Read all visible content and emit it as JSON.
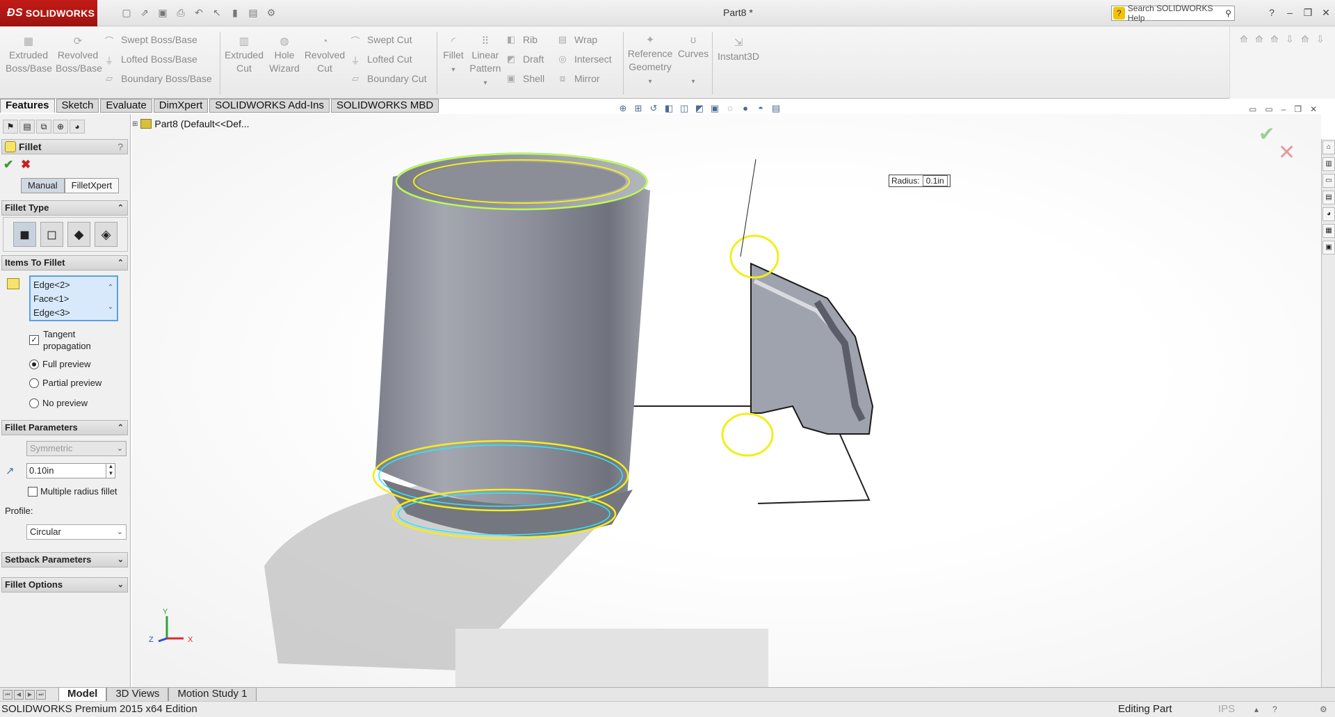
{
  "app": {
    "brand": "SOLIDWORKS",
    "document_title": "Part8 *"
  },
  "search": {
    "placeholder": "Search SOLIDWORKS Help"
  },
  "commands": {
    "extruded_boss": "Extruded Boss/Base",
    "revolved_boss": "Revolved Boss/Base",
    "swept_boss": "Swept Boss/Base",
    "lofted_boss": "Lofted Boss/Base",
    "boundary_boss": "Boundary Boss/Base",
    "extruded_cut": "Extruded Cut",
    "hole_wizard": "Hole Wizard",
    "revolved_cut": "Revolved Cut",
    "swept_cut": "Swept Cut",
    "lofted_cut": "Lofted Cut",
    "boundary_cut": "Boundary Cut",
    "fillet": "Fillet",
    "linear_pattern": "Linear Pattern",
    "rib": "Rib",
    "draft": "Draft",
    "shell": "Shell",
    "wrap": "Wrap",
    "intersect": "Intersect",
    "mirror": "Mirror",
    "reference_geometry": "Reference Geometry",
    "curves": "Curves",
    "instant3d": "Instant3D"
  },
  "tabs": [
    "Features",
    "Sketch",
    "Evaluate",
    "DimXpert",
    "SOLIDWORKS Add-Ins",
    "SOLIDWORKS MBD"
  ],
  "tree": {
    "root": "Part8  (Default<<Def..."
  },
  "property_manager": {
    "title": "Fillet",
    "help": "?",
    "mode_tabs": [
      "Manual",
      "FilletXpert"
    ],
    "fillet_type": {
      "header": "Fillet Type"
    },
    "items_to_fillet": {
      "header": "Items To Fillet",
      "items": [
        "Edge<2>",
        "Face<1>",
        "Edge<3>"
      ],
      "tangent_propagation": "Tangent propagation",
      "tangent_checked": true,
      "preview_options": [
        "Full preview",
        "Partial preview",
        "No preview"
      ],
      "preview_selected": "Full preview"
    },
    "fillet_parameters": {
      "header": "Fillet Parameters",
      "symmetric": "Symmetric",
      "radius": "0.10in",
      "multiple_radius": "Multiple radius fillet",
      "multiple_radius_checked": false,
      "profile_label": "Profile:",
      "profile": "Circular"
    },
    "setback_parameters": {
      "header": "Setback Parameters"
    },
    "fillet_options": {
      "header": "Fillet Options"
    }
  },
  "callout": {
    "label": "Radius:",
    "value": "0.1in"
  },
  "triad": {
    "x": "X",
    "y": "Y",
    "z": "Z"
  },
  "bottom_tabs": [
    "Model",
    "3D Views",
    "Motion Study 1"
  ],
  "status": {
    "edition": "SOLIDWORKS Premium 2015 x64 Edition",
    "mode": "Editing Part",
    "units": "IPS"
  },
  "colors": {
    "brand_red": "#c21b17",
    "preview_yellow": "#f2ee1c",
    "selection_blue": "#5aa0e6",
    "model_gray": "#8a8d96"
  }
}
